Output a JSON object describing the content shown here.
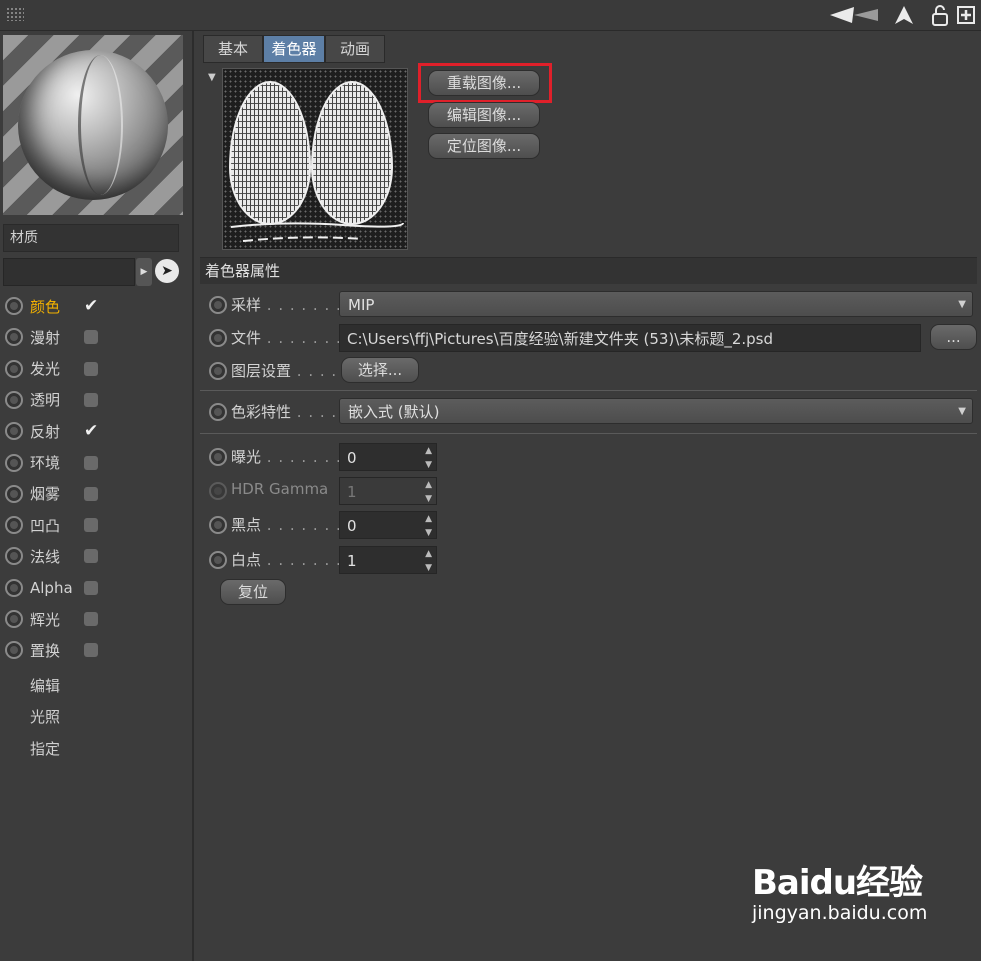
{
  "toolbar": {
    "icons": [
      "grip-icon",
      "back-arrow-icon",
      "up-arrow-icon",
      "lock-icon",
      "new-panel-icon"
    ]
  },
  "material": {
    "name": "材质",
    "channels": [
      {
        "label": "颜色",
        "checked": true,
        "active": true
      },
      {
        "label": "漫射",
        "checked": false
      },
      {
        "label": "发光",
        "checked": false
      },
      {
        "label": "透明",
        "checked": false
      },
      {
        "label": "反射",
        "checked": true
      },
      {
        "label": "环境",
        "checked": false
      },
      {
        "label": "烟雾",
        "checked": false
      },
      {
        "label": "凹凸",
        "checked": false
      },
      {
        "label": "法线",
        "checked": false
      },
      {
        "label": "Alpha",
        "checked": false
      },
      {
        "label": "辉光",
        "checked": false
      },
      {
        "label": "置换",
        "checked": false
      }
    ],
    "extra_items": [
      "编辑",
      "光照",
      "指定"
    ]
  },
  "tabs": [
    {
      "label": "基本",
      "active": false
    },
    {
      "label": "着色器",
      "active": true
    },
    {
      "label": "动画",
      "active": false
    }
  ],
  "image_buttons": {
    "reload": "重载图像...",
    "edit": "编辑图像...",
    "locate": "定位图像..."
  },
  "shader_props": {
    "section_title": "着色器属性",
    "sampling": {
      "label": "采样",
      "dots": " . . . . . . . .",
      "value": "MIP"
    },
    "file": {
      "label": "文件",
      "dots": " . . . . . . . .",
      "value": "C:\\Users\\ffj\\Pictures\\百度经验\\新建文件夹 (53)\\未标题_2.psd",
      "browse": "..."
    },
    "layer": {
      "label": "图层设置",
      "dots": " . . . .",
      "button": "选择..."
    },
    "color_profile": {
      "label": "色彩特性",
      "dots": " . . . .",
      "value": "嵌入式 (默认)"
    },
    "exposure": {
      "label": "曝光",
      "dots": " . . . . . . . .",
      "value": "0"
    },
    "hdr_gamma": {
      "label": "HDR Gamma",
      "value": "1"
    },
    "black_point": {
      "label": "黑点",
      "dots": " . . . . . . . .",
      "value": "0"
    },
    "white_point": {
      "label": "白点",
      "dots": " . . . . . . . .",
      "value": "1"
    },
    "reset": "复位"
  },
  "watermark": {
    "logo": "Baidu经验",
    "url": "jingyan.baidu.com"
  },
  "colors": {
    "background": "#3c3c3c",
    "active_tab": "#5d7fa6",
    "active_channel": "#f2b100",
    "highlight": "#e0202a"
  }
}
